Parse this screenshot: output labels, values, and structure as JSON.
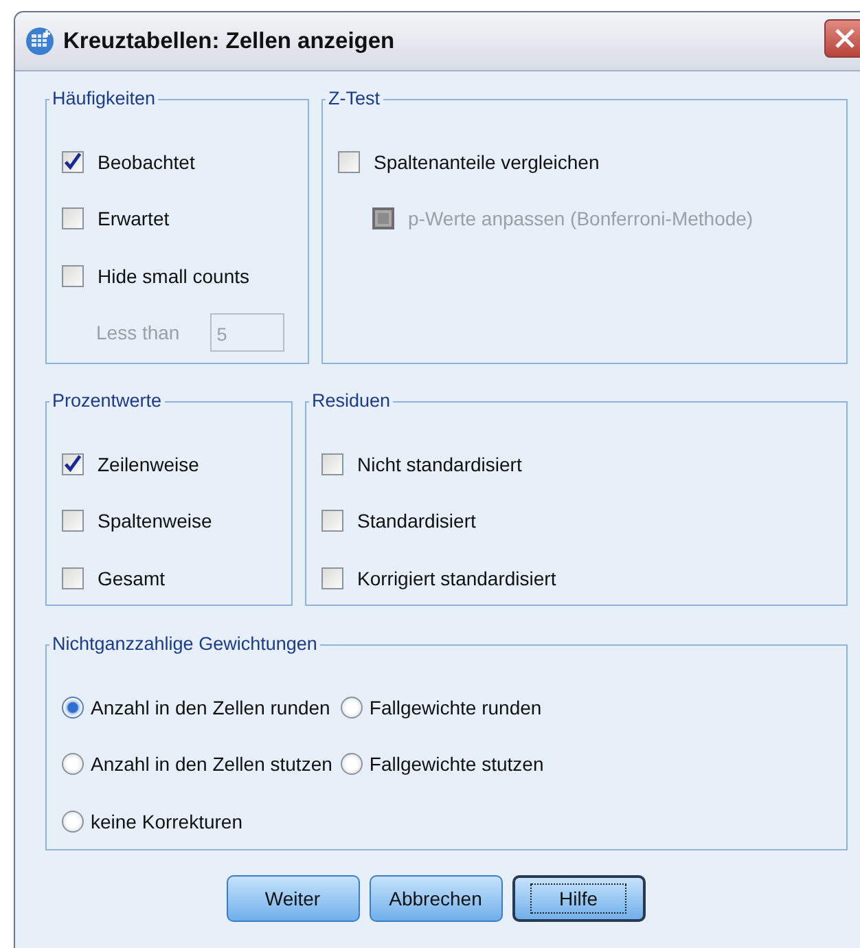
{
  "window": {
    "title": "Kreuztabellen: Zellen anzeigen"
  },
  "group_rows": [
    [
      {
        "title": "Häufigkeiten",
        "items": [
          {
            "kind": "checkbox",
            "label": "Beobachtet",
            "checked": true,
            "disabled": false,
            "indent": false
          },
          {
            "kind": "checkbox",
            "label": "Erwartet",
            "checked": false,
            "disabled": false,
            "indent": false
          },
          {
            "kind": "checkbox",
            "label": "Hide small counts",
            "checked": false,
            "disabled": false,
            "indent": false
          },
          {
            "kind": "number",
            "label": "Less than",
            "value": "5",
            "disabled": true,
            "indent": true
          }
        ]
      },
      {
        "title": "Z-Test",
        "items": [
          {
            "kind": "checkbox",
            "label": "Spaltenanteile vergleichen",
            "checked": false,
            "disabled": false,
            "indent": false
          },
          {
            "kind": "checkbox",
            "label": "p-Werte anpassen (Bonferroni-Methode)",
            "checked": false,
            "disabled": true,
            "indent": true
          }
        ]
      }
    ],
    [
      {
        "title": "Prozentwerte",
        "items": [
          {
            "kind": "checkbox",
            "label": "Zeilenweise",
            "checked": true,
            "disabled": false,
            "indent": false
          },
          {
            "kind": "checkbox",
            "label": "Spaltenweise",
            "checked": false,
            "disabled": false,
            "indent": false
          },
          {
            "kind": "checkbox",
            "label": "Gesamt",
            "checked": false,
            "disabled": false,
            "indent": false
          }
        ]
      },
      {
        "title": "Residuen",
        "items": [
          {
            "kind": "checkbox",
            "label": "Nicht standardisiert",
            "checked": false,
            "disabled": false,
            "indent": false
          },
          {
            "kind": "checkbox",
            "label": "Standardisiert",
            "checked": false,
            "disabled": false,
            "indent": false
          },
          {
            "kind": "checkbox",
            "label": "Korrigiert standardisiert",
            "checked": false,
            "disabled": false,
            "indent": false
          }
        ]
      }
    ]
  ],
  "radio_group": {
    "title": "Nichtganzzahlige Gewichtungen",
    "options": [
      {
        "label": "Anzahl in den Zellen runden",
        "selected": true
      },
      {
        "label": "Fallgewichte runden",
        "selected": false
      },
      {
        "label": "Anzahl in den Zellen stutzen",
        "selected": false
      },
      {
        "label": "Fallgewichte stutzen",
        "selected": false
      },
      {
        "label": "keine Korrekturen",
        "selected": false
      }
    ]
  },
  "buttons": [
    {
      "label": "Weiter",
      "focused": false
    },
    {
      "label": "Abbrechen",
      "focused": false
    },
    {
      "label": "Hilfe",
      "focused": true
    }
  ]
}
